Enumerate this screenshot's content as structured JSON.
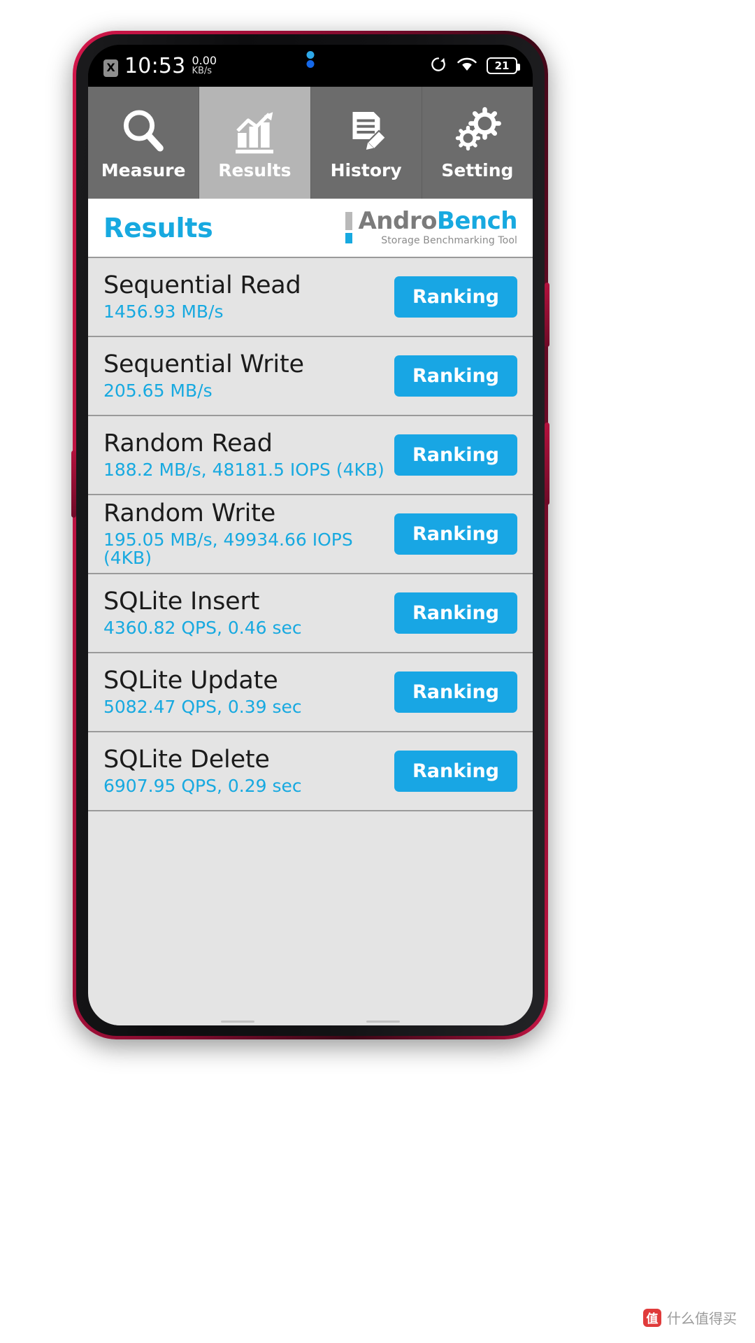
{
  "statusbar": {
    "notification_icon": "x-badge-icon",
    "notification_label": "X",
    "time": "10:53",
    "network_rate": "0.00",
    "network_unit": "KB/s",
    "rotation_icon": "rotation-lock-icon",
    "wifi_icon": "wifi-icon",
    "battery_icon": "battery-icon",
    "battery_level": "21"
  },
  "tabs": [
    {
      "label": "Measure",
      "icon": "magnifier-icon",
      "active": false
    },
    {
      "label": "Results",
      "icon": "bar-chart-icon",
      "active": true
    },
    {
      "label": "History",
      "icon": "document-pencil-icon",
      "active": false
    },
    {
      "label": "Setting",
      "icon": "gears-icon",
      "active": false
    }
  ],
  "header": {
    "title": "Results",
    "logo_andro": "Andro",
    "logo_bench": "Bench",
    "logo_subtitle": "Storage Benchmarking Tool"
  },
  "ranking_label": "Ranking",
  "results": [
    {
      "name": "Sequential Read",
      "value": "1456.93 MB/s"
    },
    {
      "name": "Sequential Write",
      "value": "205.65 MB/s"
    },
    {
      "name": "Random Read",
      "value": "188.2 MB/s, 48181.5 IOPS (4KB)"
    },
    {
      "name": "Random Write",
      "value": "195.05 MB/s, 49934.66 IOPS (4KB)"
    },
    {
      "name": "SQLite Insert",
      "value": "4360.82 QPS, 0.46 sec"
    },
    {
      "name": "SQLite Update",
      "value": "5082.47 QPS, 0.39 sec"
    },
    {
      "name": "SQLite Delete",
      "value": "6907.95 QPS, 0.29 sec"
    }
  ],
  "watermark": {
    "badge": "值",
    "text": "什么值得买"
  },
  "colors": {
    "accent_blue": "#17a9e0",
    "tab_inactive": "#6c6c6c",
    "tab_active": "#b5b5b5",
    "list_bg": "#e4e4e4",
    "phone_body": "#c2164a"
  }
}
